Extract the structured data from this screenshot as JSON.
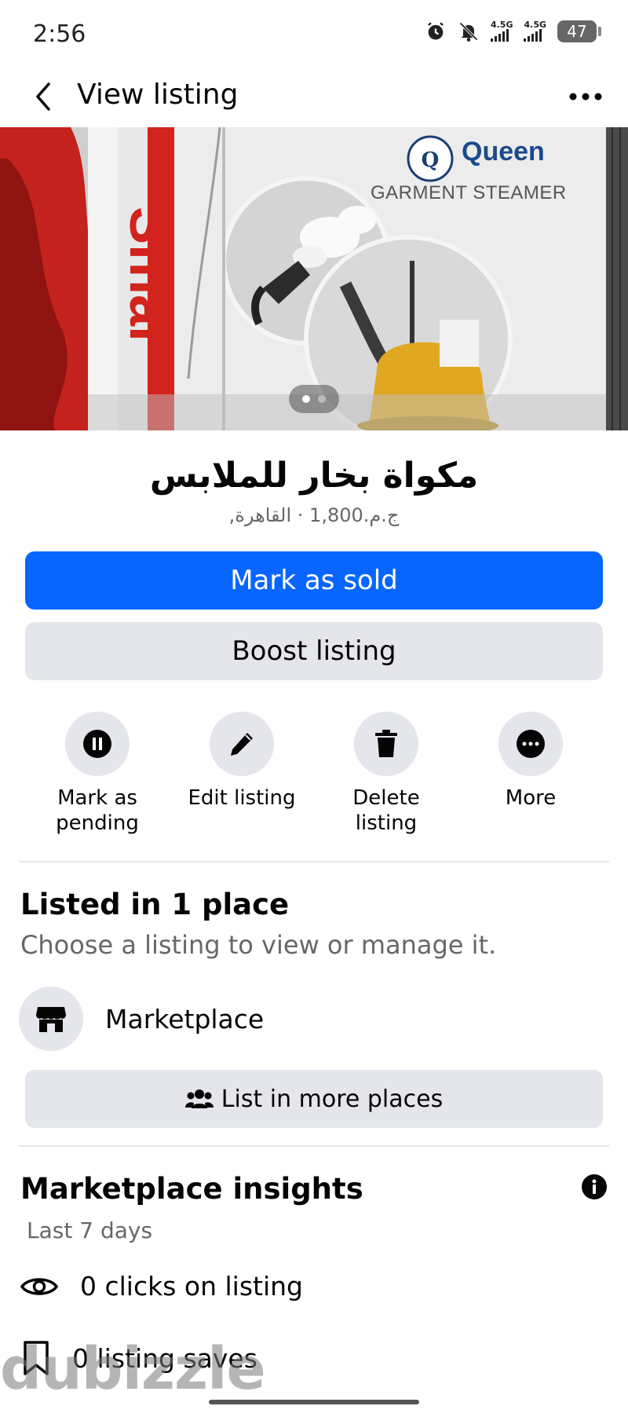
{
  "status_bar": {
    "time": "2:56",
    "network_1": "4.5G",
    "network_2": "4.5G",
    "battery": "47",
    "icons": [
      "alarm-icon",
      "mute-icon",
      "signal-icon",
      "signal-icon",
      "battery-icon"
    ]
  },
  "header": {
    "title": "View listing"
  },
  "photo": {
    "brand_text": "Queen",
    "product_text": "GARMENT STEAMER",
    "side_text": "Smar",
    "page_count": 2,
    "current_page": 1
  },
  "listing": {
    "title": "مكواة بخار للملابس",
    "meta": "ج.م.1,800 · القاهرة,"
  },
  "buttons": {
    "mark_sold": "Mark as sold",
    "boost": "Boost listing"
  },
  "actions": [
    {
      "label": "Mark as pending",
      "icon": "pause-icon"
    },
    {
      "label": "Edit listing",
      "icon": "pencil-icon"
    },
    {
      "label": "Delete listing",
      "icon": "trash-icon"
    },
    {
      "label": "More",
      "icon": "more-icon"
    }
  ],
  "listed": {
    "title": "Listed in 1 place",
    "subtitle": "Choose a listing to view or manage it.",
    "place": "Marketplace",
    "list_more": "List in more places"
  },
  "insights": {
    "title": "Marketplace insights",
    "period": "Last 7 days",
    "clicks": "0 clicks on listing",
    "saves": "0 listing saves"
  },
  "watermark": "dubizzle",
  "colors": {
    "primary": "#0866ff",
    "secondary_bg": "#e4e6eb",
    "muted_text": "#65676b"
  }
}
